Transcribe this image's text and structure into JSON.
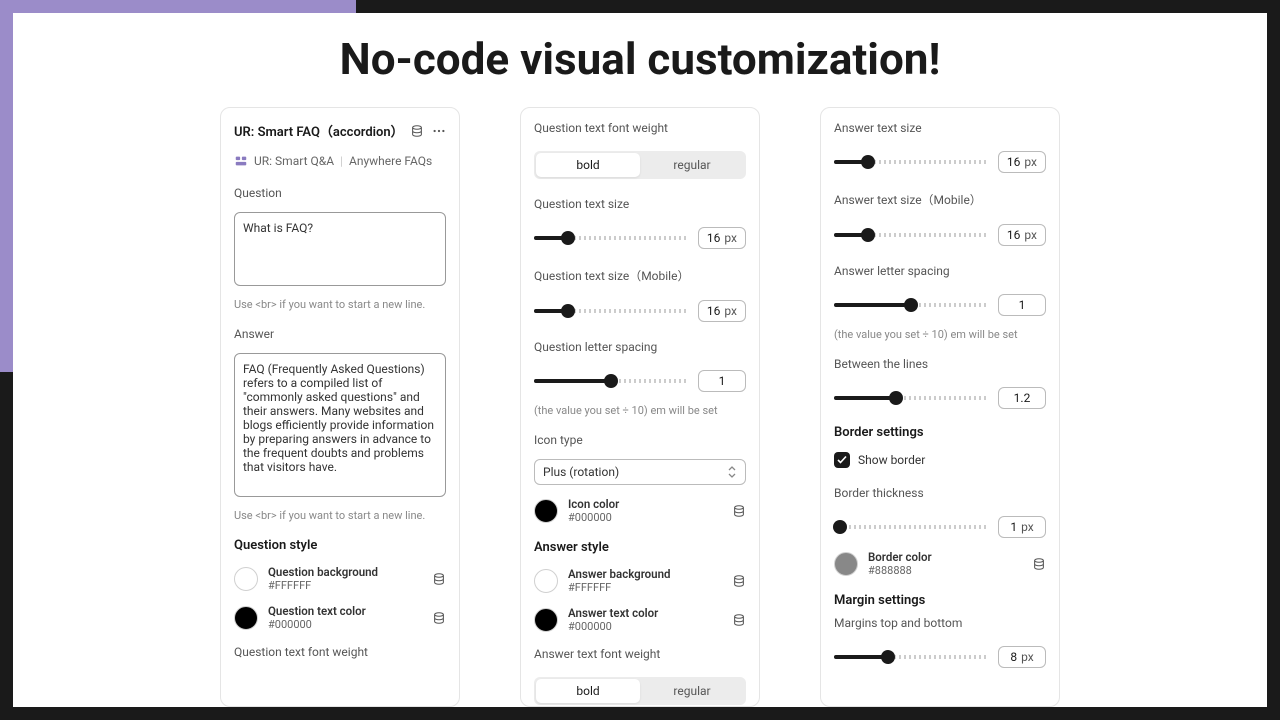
{
  "heading": "No-code visual customization!",
  "panel1": {
    "title": "UR: Smart FAQ（accordion）",
    "sub_app": "UR: Smart Q&A",
    "sub_tag": "Anywhere FAQs",
    "question_label": "Question",
    "question_value": "What is FAQ?",
    "question_helper": "Use <br> if you want to start a new line.",
    "answer_label": "Answer",
    "answer_value": "FAQ (Frequently Asked Questions) refers to a compiled list of \"commonly asked questions\" and their answers. Many websites and blogs efficiently provide information by preparing answers in advance to the frequent doubts and problems that visitors have.",
    "answer_helper": "Use <br> if you want to start a new line.",
    "question_style_title": "Question style",
    "q_bg": {
      "label": "Question background",
      "hex": "#FFFFFF"
    },
    "q_color": {
      "label": "Question text color",
      "hex": "#000000"
    },
    "q_font_weight_label": "Question text font weight"
  },
  "panel2": {
    "q_font_weight_label": "Question text font weight",
    "bold": "bold",
    "regular": "regular",
    "q_size_label": "Question text size",
    "q_size_value": "16",
    "px": "px",
    "q_size_m_label": "Question text size（Mobile）",
    "q_size_m_value": "16",
    "q_spacing_label": "Question letter spacing",
    "q_spacing_value": "1",
    "spacing_helper": "(the value you set ÷ 10) em will be set",
    "icon_type_label": "Icon type",
    "icon_type_value": "Plus (rotation)",
    "icon_color": {
      "label": "Icon color",
      "hex": "#000000"
    },
    "answer_style_title": "Answer style",
    "a_bg": {
      "label": "Answer background",
      "hex": "#FFFFFF"
    },
    "a_color": {
      "label": "Answer text color",
      "hex": "#000000"
    },
    "a_font_weight_label": "Answer text font weight",
    "a_bold": "bold",
    "a_regular": "regular"
  },
  "panel3": {
    "a_size_label": "Answer text size",
    "a_size_value": "16",
    "px": "px",
    "a_size_m_label": "Answer text size（Mobile）",
    "a_size_m_value": "16",
    "a_spacing_label": "Answer letter spacing",
    "a_spacing_value": "1",
    "spacing_helper": "(the value you set ÷ 10) em will be set",
    "line_label": "Between the lines",
    "line_value": "1.2",
    "border_title": "Border settings",
    "show_border_label": "Show border",
    "border_thick_label": "Border thickness",
    "border_thick_value": "1",
    "border_color": {
      "label": "Border color",
      "hex": "#888888"
    },
    "margin_title": "Margin settings",
    "margin_label": "Margins top and bottom",
    "margin_value": "8"
  }
}
